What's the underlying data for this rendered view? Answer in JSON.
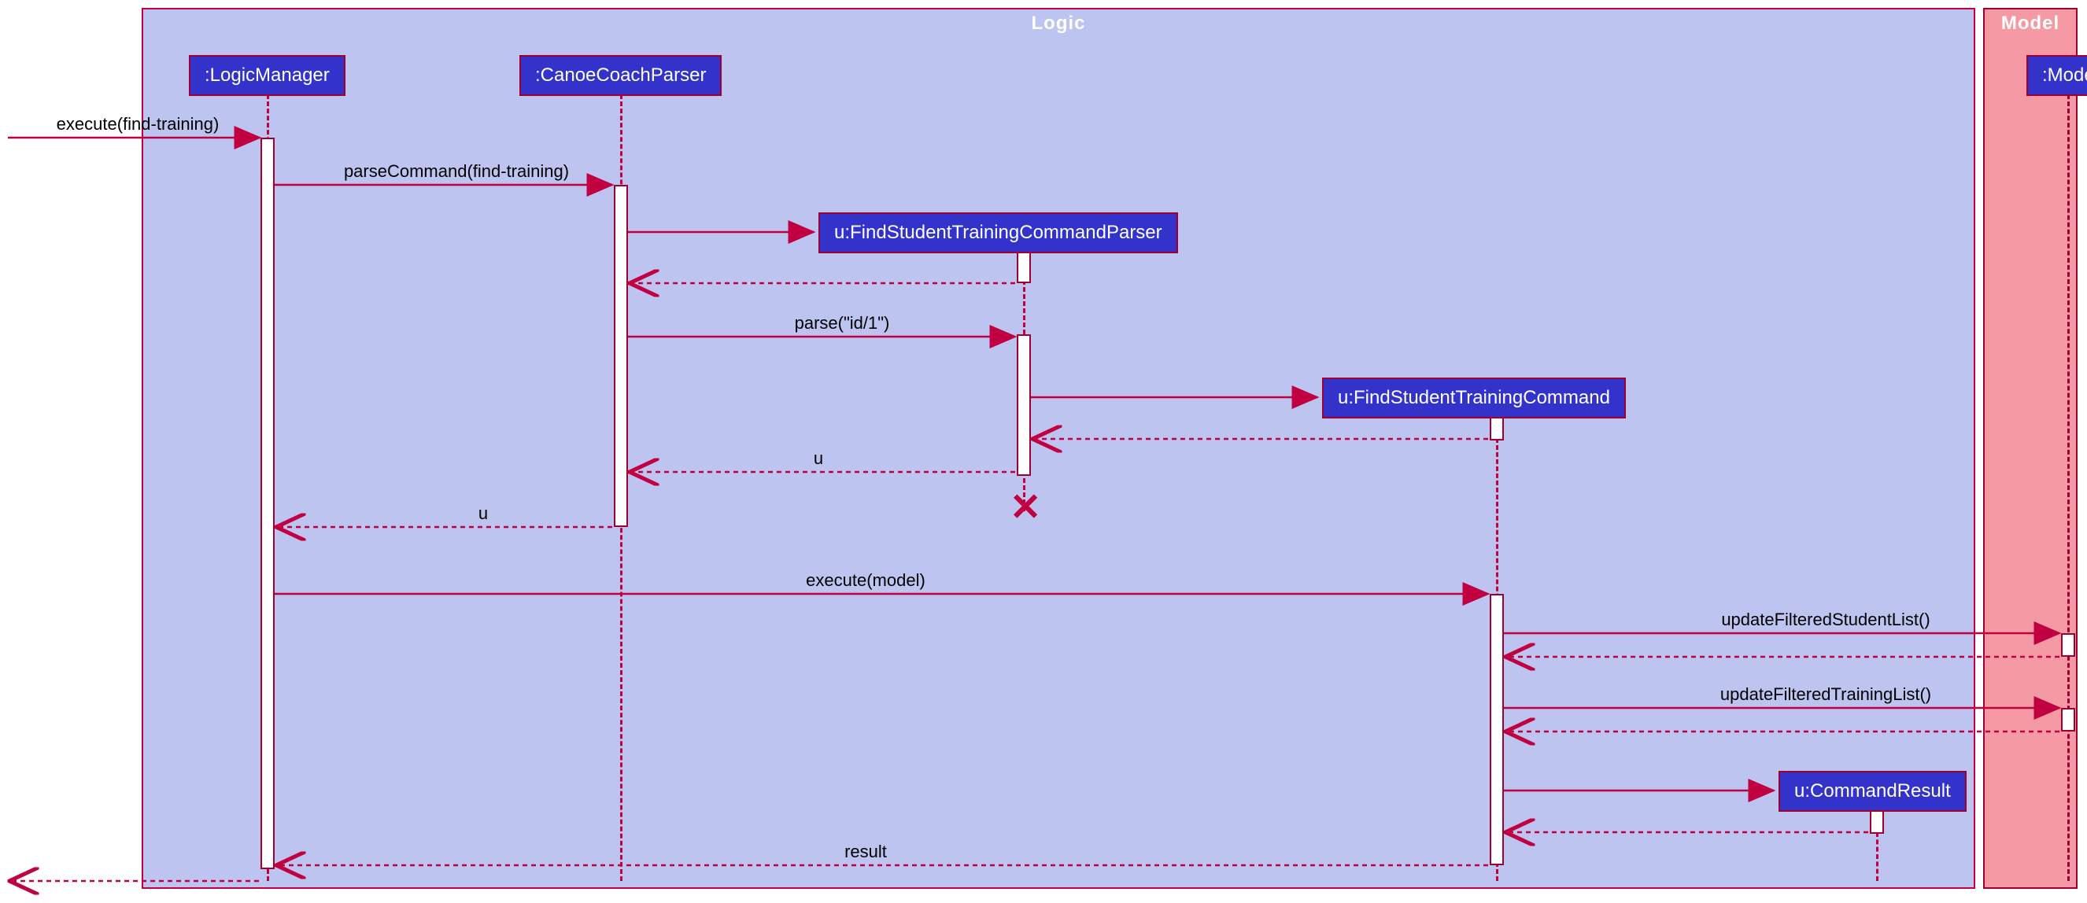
{
  "frames": {
    "logic": {
      "title": "Logic"
    },
    "model": {
      "title": "Model"
    }
  },
  "participants": {
    "logicManager": ":LogicManager",
    "canoeCoachParser": ":CanoeCoachParser",
    "findStudentTrainingCommandParser": "u:FindStudentTrainingCommandParser",
    "findStudentTrainingCommand": "u:FindStudentTrainingCommand",
    "commandResult": "u:CommandResult",
    "model": ":Model"
  },
  "messages": {
    "execute_findTraining": "execute(find-training)",
    "parseCommand": "parseCommand(find-training)",
    "parse_id1": "parse(\"id/1\")",
    "return_u1": "u",
    "return_u2": "u",
    "execute_model": "execute(model)",
    "updateFilteredStudentList": "updateFilteredStudentList()",
    "updateFilteredTrainingList": "updateFilteredTrainingList()",
    "result": "result"
  }
}
